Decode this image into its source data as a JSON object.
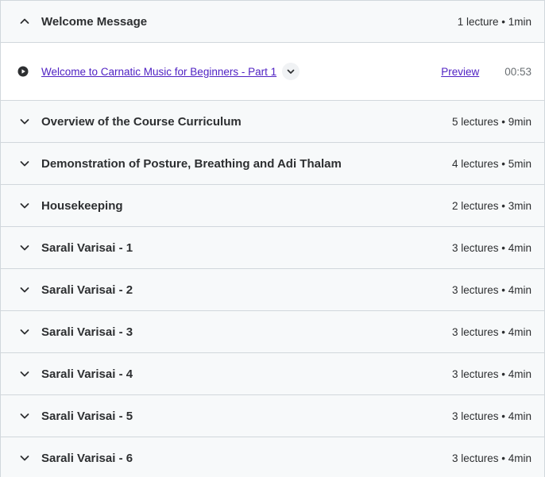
{
  "sections": [
    {
      "title": "Welcome Message",
      "meta": "1 lecture • 1min",
      "expanded": true,
      "lectures": [
        {
          "title": "Welcome to Carnatic Music for Beginners - Part 1",
          "preview": "Preview",
          "duration": "00:53"
        }
      ]
    },
    {
      "title": "Overview of the Course Curriculum",
      "meta": "5 lectures • 9min",
      "expanded": false
    },
    {
      "title": "Demonstration of Posture, Breathing and Adi Thalam",
      "meta": "4 lectures • 5min",
      "expanded": false
    },
    {
      "title": "Housekeeping",
      "meta": "2 lectures • 3min",
      "expanded": false
    },
    {
      "title": "Sarali Varisai - 1",
      "meta": "3 lectures • 4min",
      "expanded": false
    },
    {
      "title": "Sarali Varisai - 2",
      "meta": "3 lectures • 4min",
      "expanded": false
    },
    {
      "title": "Sarali Varisai - 3",
      "meta": "3 lectures • 4min",
      "expanded": false
    },
    {
      "title": "Sarali Varisai - 4",
      "meta": "3 lectures • 4min",
      "expanded": false
    },
    {
      "title": "Sarali Varisai - 5",
      "meta": "3 lectures • 4min",
      "expanded": false
    },
    {
      "title": "Sarali Varisai - 6",
      "meta": "3 lectures • 4min",
      "expanded": false
    }
  ],
  "icons": {
    "collapse": "chevron-up-icon",
    "expand": "chevron-down-icon",
    "play": "play-circle-icon"
  },
  "colors": {
    "link": "#5022c3",
    "header_bg": "#f7f9fa",
    "border": "#d1d7dc"
  }
}
